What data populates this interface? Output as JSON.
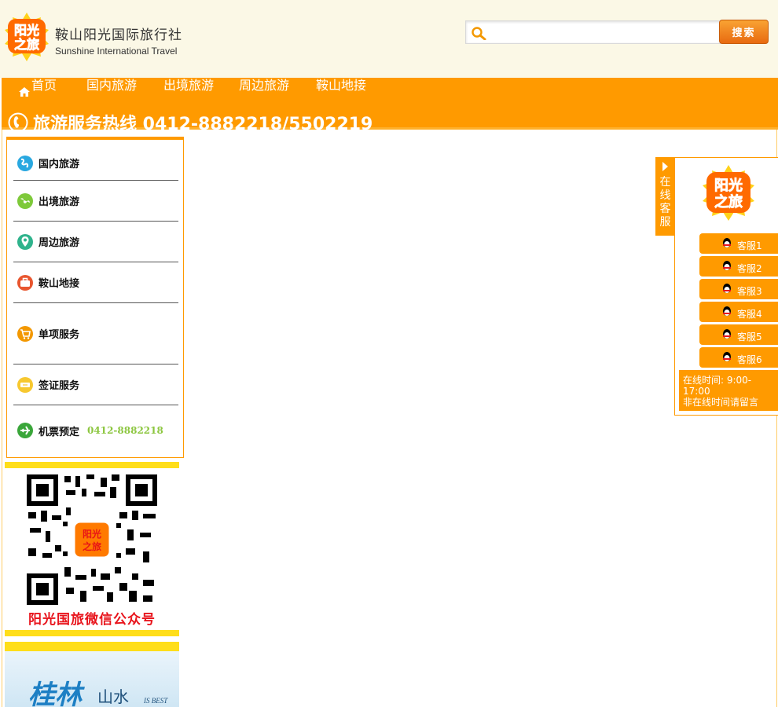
{
  "header": {
    "brand_cn": "鞍山阳光国际旅行社",
    "brand_en": "Sunshine International Travel",
    "search": {
      "value": "",
      "placeholder": "",
      "button_label": "搜索"
    }
  },
  "nav": {
    "items": [
      {
        "label": "首页"
      },
      {
        "label": "国内旅游"
      },
      {
        "label": "出境旅游"
      },
      {
        "label": "周边旅游"
      },
      {
        "label": "鞍山地接"
      }
    ],
    "hotline": "旅游服务热线 0412-8882218/5502219"
  },
  "sidebar": {
    "items": [
      {
        "label": "国内旅游",
        "icon": "globe-icon",
        "color": "#29a8e0"
      },
      {
        "label": "出境旅游",
        "icon": "earth-icon",
        "color": "#7ec93a"
      },
      {
        "label": "周边旅游",
        "icon": "location-pin-icon",
        "color": "#2fb38c"
      },
      {
        "label": "鞍山地接",
        "icon": "briefcase-icon",
        "color": "#e8562f"
      },
      {
        "label": "单项服务",
        "icon": "cart-icon",
        "color": "#f39800"
      },
      {
        "label": "签证服务",
        "icon": "ticket-icon",
        "color": "#f7c830"
      },
      {
        "label": "机票预定",
        "icon": "airplane-icon",
        "color": "#3aa63a",
        "phone": "0412-8882218"
      }
    ]
  },
  "qr": {
    "caption": "阳光国旅微信公众号"
  },
  "banner": {
    "title_cn": "桂林",
    "title_cn2": "山水",
    "title_en": "IS BEST"
  },
  "customer_service": {
    "tab_label": "在线客服",
    "agents": [
      {
        "label": "客服1"
      },
      {
        "label": "客服2"
      },
      {
        "label": "客服3"
      },
      {
        "label": "客服4"
      },
      {
        "label": "客服5"
      },
      {
        "label": "客服6"
      }
    ],
    "hours_line1": "在线时间: 9:00-",
    "hours_line2": "17:00",
    "hours_line3": "非在线时间请留言"
  },
  "colors": {
    "accent": "#ff9a00",
    "highlight": "#ffde1a",
    "header_bg": "#fbf8e6"
  }
}
